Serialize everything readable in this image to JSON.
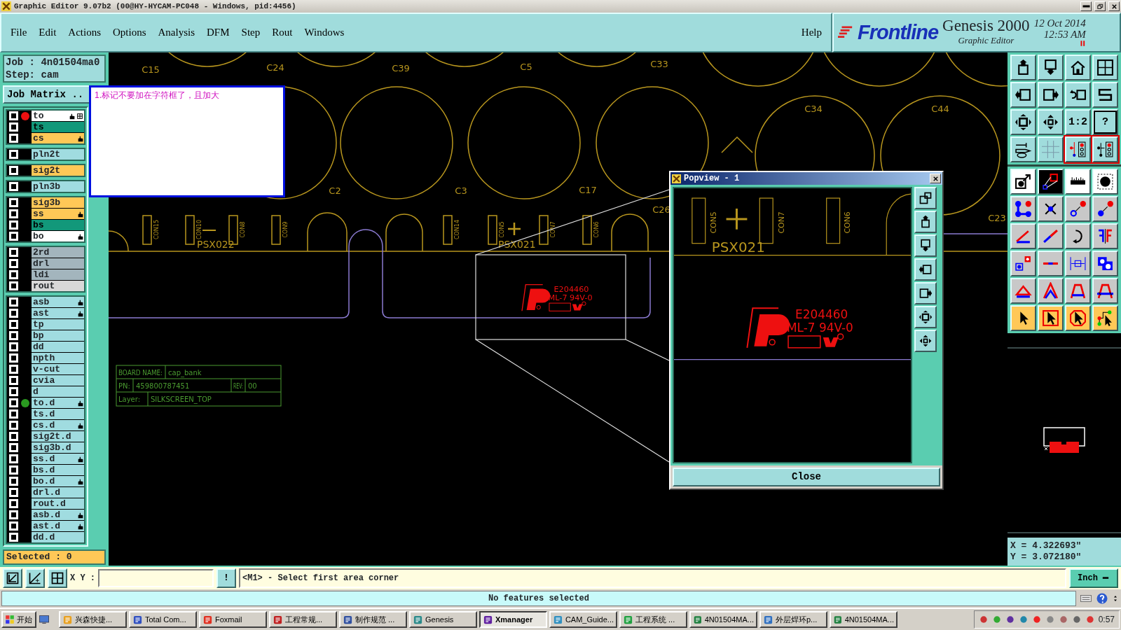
{
  "title_bar": {
    "title": "Graphic Editor 9.07b2 (00@HY-HYCAM-PC048 - Windows, pid:4456)"
  },
  "menu": [
    "File",
    "Edit",
    "Actions",
    "Options",
    "Analysis",
    "DFM",
    "Step",
    "Rout",
    "Windows"
  ],
  "help": "Help",
  "brand": {
    "logo": "Frontline",
    "product": "Genesis 2000",
    "date": "12 Oct 2014",
    "time": "12:53 AM",
    "subtitle": "Graphic Editor"
  },
  "job_panel": {
    "job": "Job : 4n01504ma0",
    "step": "Step: cam",
    "matrix_button": "Job Matrix ..",
    "selected": "Selected : 0"
  },
  "layer_groups": [
    [
      {
        "name": "to",
        "color": "#ffffff",
        "checked": false,
        "work": true,
        "affected": false,
        "marked": true,
        "grid": true
      },
      {
        "name": "ts",
        "color": "#12987a",
        "checked": false,
        "work": false,
        "affected": false,
        "marked": false,
        "grid": false
      },
      {
        "name": "cs",
        "color": "#ffc857",
        "checked": false,
        "work": false,
        "affected": false,
        "marked": true,
        "grid": false
      }
    ],
    [
      {
        "name": "pln2t",
        "color": "#a0dce0",
        "checked": false,
        "work": false,
        "affected": false,
        "marked": false,
        "grid": false
      }
    ],
    [
      {
        "name": "sig2t",
        "color": "#ffc857",
        "checked": false,
        "work": false,
        "affected": false,
        "marked": false,
        "grid": false
      }
    ],
    [
      {
        "name": "pln3b",
        "color": "#a0dce0",
        "checked": false,
        "work": false,
        "affected": false,
        "marked": false,
        "grid": false
      }
    ],
    [
      {
        "name": "sig3b",
        "color": "#ffc857",
        "checked": false,
        "work": false,
        "affected": false,
        "marked": false,
        "grid": false
      },
      {
        "name": "ss",
        "color": "#ffc857",
        "checked": false,
        "work": false,
        "affected": false,
        "marked": true,
        "grid": false
      },
      {
        "name": "bs",
        "color": "#12987a",
        "checked": false,
        "work": false,
        "affected": false,
        "marked": false,
        "grid": false
      },
      {
        "name": "bo",
        "color": "#ffffff",
        "checked": false,
        "work": false,
        "affected": false,
        "marked": true,
        "grid": false
      }
    ],
    [
      {
        "name": "2rd",
        "color": "#a3b5bd",
        "checked": false,
        "work": false,
        "affected": false,
        "marked": false,
        "grid": false
      },
      {
        "name": "drl",
        "color": "#a3b5bd",
        "checked": false,
        "work": false,
        "affected": false,
        "marked": false,
        "grid": false
      },
      {
        "name": "ldi",
        "color": "#a3b5bd",
        "checked": false,
        "work": false,
        "affected": false,
        "marked": false,
        "grid": false
      },
      {
        "name": "rout",
        "color": "#d8d8d8",
        "checked": false,
        "work": false,
        "affected": false,
        "marked": false,
        "grid": false
      }
    ],
    [
      {
        "name": "asb",
        "color": "#a0dce0",
        "checked": false,
        "work": false,
        "affected": false,
        "marked": true,
        "grid": false
      },
      {
        "name": "ast",
        "color": "#a0dce0",
        "checked": false,
        "work": false,
        "affected": false,
        "marked": true,
        "grid": false
      },
      {
        "name": "tp",
        "color": "#a0dce0",
        "checked": false,
        "work": false,
        "affected": false,
        "marked": false,
        "grid": false
      },
      {
        "name": "bp",
        "color": "#a0dce0",
        "checked": false,
        "work": false,
        "affected": false,
        "marked": false,
        "grid": false
      },
      {
        "name": "dd",
        "color": "#a0dce0",
        "checked": false,
        "work": false,
        "affected": false,
        "marked": false,
        "grid": false
      },
      {
        "name": "npth",
        "color": "#a0dce0",
        "checked": false,
        "work": false,
        "affected": false,
        "marked": false,
        "grid": false
      },
      {
        "name": "v-cut",
        "color": "#a0dce0",
        "checked": false,
        "work": false,
        "affected": false,
        "marked": false,
        "grid": false
      },
      {
        "name": "cvia",
        "color": "#a0dce0",
        "checked": false,
        "work": false,
        "affected": false,
        "marked": false,
        "grid": false
      },
      {
        "name": "d",
        "color": "#a0dce0",
        "checked": false,
        "work": false,
        "affected": false,
        "marked": false,
        "grid": false
      },
      {
        "name": "to.d",
        "color": "#a0dce0",
        "checked": false,
        "work": false,
        "affected": true,
        "marked": true,
        "grid": false
      },
      {
        "name": "ts.d",
        "color": "#a0dce0",
        "checked": false,
        "work": false,
        "affected": false,
        "marked": false,
        "grid": false
      },
      {
        "name": "cs.d",
        "color": "#a0dce0",
        "checked": false,
        "work": false,
        "affected": false,
        "marked": true,
        "grid": false
      },
      {
        "name": "sig2t.d",
        "color": "#a0dce0",
        "checked": false,
        "work": false,
        "affected": false,
        "marked": false,
        "grid": false
      },
      {
        "name": "sig3b.d",
        "color": "#a0dce0",
        "checked": false,
        "work": false,
        "affected": false,
        "marked": false,
        "grid": false
      },
      {
        "name": "ss.d",
        "color": "#a0dce0",
        "checked": false,
        "work": false,
        "affected": false,
        "marked": true,
        "grid": false
      },
      {
        "name": "bs.d",
        "color": "#a0dce0",
        "checked": false,
        "work": false,
        "affected": false,
        "marked": false,
        "grid": false
      },
      {
        "name": "bo.d",
        "color": "#a0dce0",
        "checked": false,
        "work": false,
        "affected": false,
        "marked": true,
        "grid": false
      },
      {
        "name": "drl.d",
        "color": "#a0dce0",
        "checked": false,
        "work": false,
        "affected": false,
        "marked": false,
        "grid": false
      },
      {
        "name": "rout.d",
        "color": "#a0dce0",
        "checked": false,
        "work": false,
        "affected": false,
        "marked": false,
        "grid": false
      },
      {
        "name": "asb.d",
        "color": "#a0dce0",
        "checked": false,
        "work": false,
        "affected": false,
        "marked": true,
        "grid": false
      },
      {
        "name": "ast.d",
        "color": "#a0dce0",
        "checked": false,
        "work": false,
        "affected": false,
        "marked": true,
        "grid": false
      },
      {
        "name": "dd.d",
        "color": "#a0dce0",
        "checked": false,
        "work": false,
        "affected": false,
        "marked": false,
        "grid": false
      }
    ]
  ],
  "note": {
    "text": "1.标记不要加在字符框了，且加大"
  },
  "canvas": {
    "component_labels": [
      "C15",
      "C24",
      "C39",
      "C5",
      "C33",
      "C34",
      "C44",
      "C2",
      "C3",
      "C17",
      "C26",
      "C23"
    ],
    "ref_labels": [
      "PSX022",
      "PSX021"
    ],
    "pin_labels": [
      "CON15",
      "CON10",
      "CON8",
      "CON9",
      "CON14",
      "CON5",
      "CON7",
      "CON6"
    ],
    "marking": [
      "E204460",
      "ML-7 94V-0"
    ],
    "board_info": [
      "BOARD NAME:",
      "cap_bank",
      "PN:",
      "459800787451",
      "REV:",
      "00",
      "Layer:",
      "SILKSCREEN_TOP"
    ]
  },
  "popview": {
    "title": "Popview - 1",
    "pin_labels": [
      "CON5",
      "CON7",
      "CON6"
    ],
    "ref_label": "PSX021",
    "marking": [
      "E204460",
      "ML-7 94V-0"
    ],
    "close": "Close"
  },
  "right_panel": {
    "zoom_label": "1:2",
    "help_label": "?",
    "x": "X = 4.322693\"",
    "y": "Y = 3.072180\""
  },
  "command_bar": {
    "xy_label": "X Y :",
    "alert": "!",
    "message": "<M1> - Select first area corner",
    "units": "Inch"
  },
  "status": "No features selected",
  "taskbar": {
    "start": "开始",
    "items": [
      {
        "label": "兴森快捷...",
        "selected": false
      },
      {
        "label": "Total Com...",
        "selected": false
      },
      {
        "label": "Foxmail",
        "selected": false
      },
      {
        "label": "工程常规...",
        "selected": false
      },
      {
        "label": "制作规范 ...",
        "selected": false
      },
      {
        "label": "Genesis",
        "selected": false
      },
      {
        "label": "Xmanager",
        "selected": true
      },
      {
        "label": "CAM_Guide...",
        "selected": false
      },
      {
        "label": "工程系统 ...",
        "selected": false
      },
      {
        "label": "4N01504MA...",
        "selected": false
      },
      {
        "label": "外层焊环p...",
        "selected": false
      },
      {
        "label": "4N01504MA...",
        "selected": false
      }
    ],
    "clock": "0:57"
  }
}
